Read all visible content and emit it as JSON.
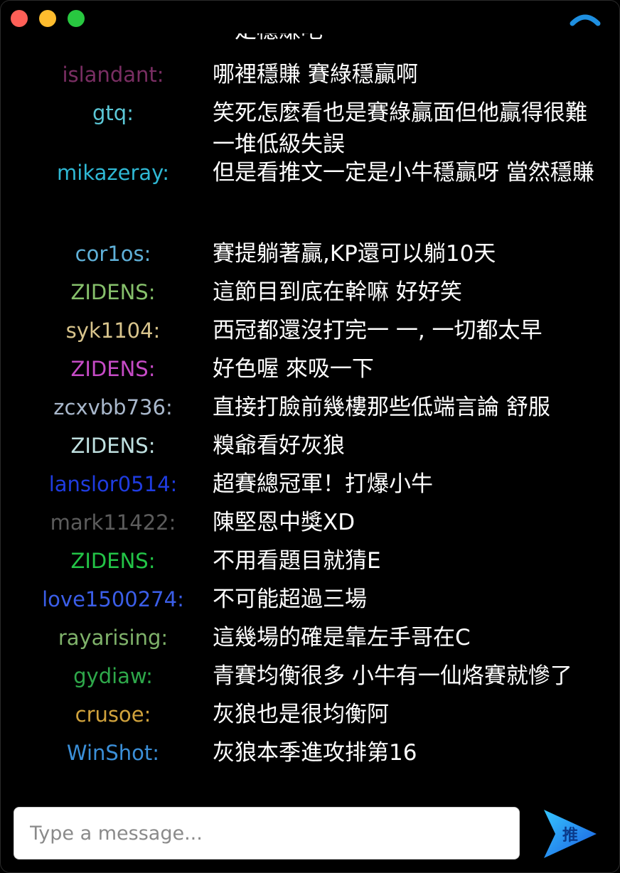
{
  "window": {
    "traffic": [
      "close",
      "minimize",
      "zoom"
    ],
    "loader_icon": "loading-arc-icon"
  },
  "messages": [
    {
      "user": "",
      "text": "一定穩賺吧",
      "color": "#ffffff"
    },
    {
      "user": "islandant:",
      "text": "哪裡穩賺 賽綠穩贏啊",
      "color": "#7a2e63"
    },
    {
      "user": "gtq:",
      "text": "笑死怎麼看也是賽綠贏面但他贏得很難一堆低級失誤",
      "color": "#5bc7d6"
    },
    {
      "user": "mikazeray:",
      "text": "但是看推文一定是小牛穩贏呀 當然穩賺",
      "color": "#2fb8d4"
    },
    {
      "user": "cor1os:",
      "text": "賽提躺著贏,KP還可以躺10天",
      "color": "#5fb0d8"
    },
    {
      "user": "ZIDENS:",
      "text": "這節目到底在幹嘛 好好笑",
      "color": "#86c06b"
    },
    {
      "user": "syk1104:",
      "text": "西冠都還沒打完一 一, 一切都太早",
      "color": "#d8c48c"
    },
    {
      "user": "ZIDENS:",
      "text": "好色喔 來吸一下",
      "color": "#c64bc6"
    },
    {
      "user": "zcxvbb736:",
      "text": "直接打臉前幾樓那些低端言論 舒服",
      "color": "#a9b8cc"
    },
    {
      "user": "ZIDENS:",
      "text": "糗爺看好灰狼",
      "color": "#bfe0e0"
    },
    {
      "user": "lanslor0514:",
      "text": "超賽總冠軍！打爆小牛",
      "color": "#1f3ce0"
    },
    {
      "user": "mark11422:",
      "text": "陳堅恩中獎XD",
      "color": "#5c5c5c"
    },
    {
      "user": "ZIDENS:",
      "text": "不用看題目就猜E",
      "color": "#23c447"
    },
    {
      "user": "love1500274:",
      "text": "不可能超過三場",
      "color": "#3b5ee8"
    },
    {
      "user": "rayarising:",
      "text": "這幾場的確是靠左手哥在C",
      "color": "#7fb26a"
    },
    {
      "user": "gydiaw:",
      "text": "青賽均衡很多 小牛有一仙烙賽就慘了",
      "color": "#2ea84a"
    },
    {
      "user": "crusoe:",
      "text": "灰狼也是很均衡阿",
      "color": "#d0a23c"
    },
    {
      "user": "WinShot:",
      "text": "灰狼本季進攻排第16",
      "color": "#3b8fd8"
    }
  ],
  "composer": {
    "placeholder": "Type a message...",
    "value": ""
  },
  "send": {
    "label": "推",
    "icon": "send-arrow-icon"
  }
}
